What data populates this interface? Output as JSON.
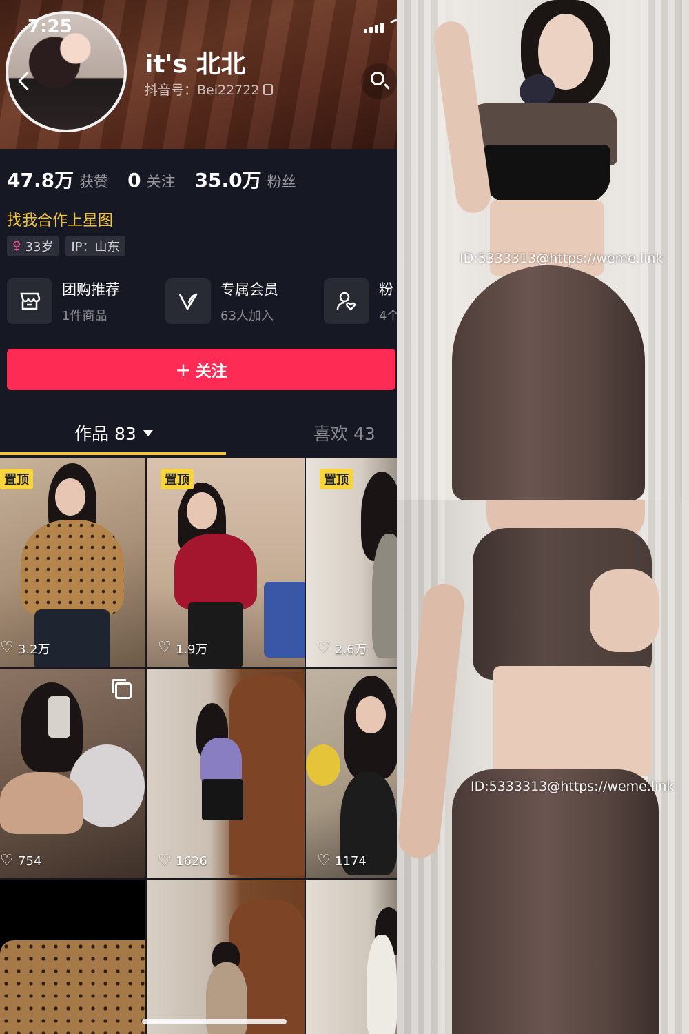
{
  "status_bar": {
    "time": "7:25"
  },
  "profile": {
    "username": "it's 北北",
    "douyin_id": "抖音号：Bei22722",
    "stats": [
      {
        "num": "47.8万",
        "label": "获赞"
      },
      {
        "num": "0",
        "label": "关注"
      },
      {
        "num": "35.0万",
        "label": "粉丝"
      }
    ],
    "bio": "找我合作上星图",
    "tags": {
      "age": "33岁",
      "ip": "IP：山东"
    }
  },
  "services": [
    {
      "icon": "storefront-icon",
      "title": "团购推荐",
      "sub": "1件商品"
    },
    {
      "icon": "v-member-icon",
      "title": "专属会员",
      "sub": "63人加入"
    },
    {
      "icon": "fans-group-icon",
      "title": "粉",
      "sub": "4个"
    }
  ],
  "follow_button": {
    "plus": "+",
    "label": "关注"
  },
  "tabs": {
    "works": "作品 83",
    "likes": "喜欢 43"
  },
  "grid": [
    {
      "pinned": "置顶",
      "likes": "3.2万"
    },
    {
      "pinned": "置顶",
      "likes": "1.9万"
    },
    {
      "pinned": "置顶",
      "likes": "2.6万"
    },
    {
      "likes": "754",
      "multi": true
    },
    {
      "likes": "1626"
    },
    {
      "likes": "1174"
    }
  ],
  "photos": {
    "watermark_top": "ID:5333313@https://weme.link",
    "watermark_bottom": "ID:5333313@https://weme.link"
  },
  "colors": {
    "accent_red": "#fe2c55",
    "bio_yellow": "#f3c43c",
    "pin_yellow": "#f8d53c"
  }
}
